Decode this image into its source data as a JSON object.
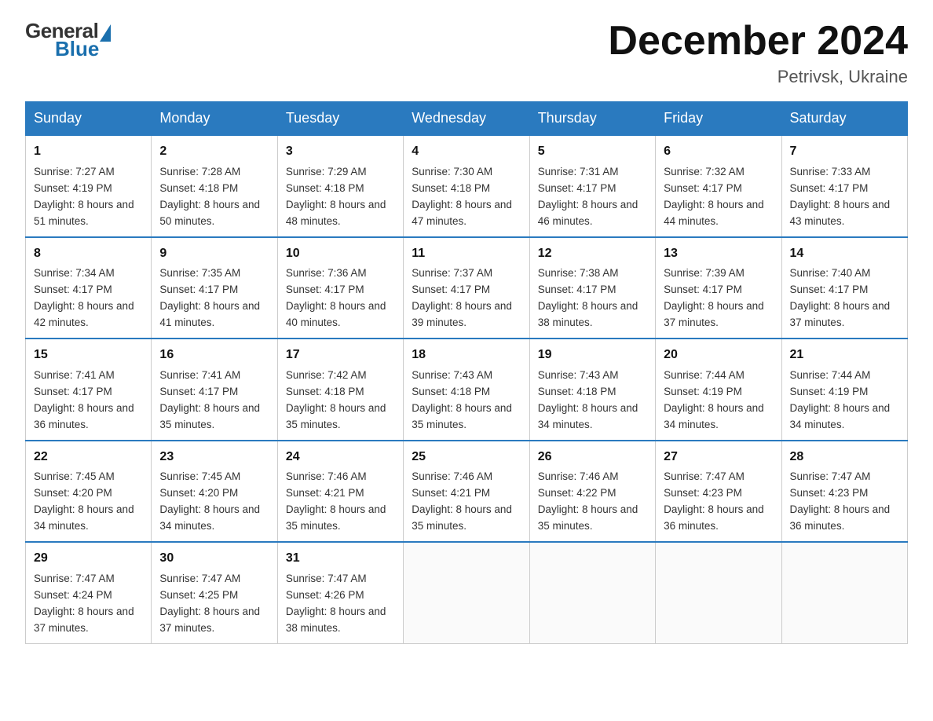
{
  "header": {
    "logo_general": "General",
    "logo_blue": "Blue",
    "month_title": "December 2024",
    "location": "Petrivsk, Ukraine"
  },
  "calendar": {
    "days_of_week": [
      "Sunday",
      "Monday",
      "Tuesday",
      "Wednesday",
      "Thursday",
      "Friday",
      "Saturday"
    ],
    "weeks": [
      [
        {
          "day": "1",
          "sunrise": "Sunrise: 7:27 AM",
          "sunset": "Sunset: 4:19 PM",
          "daylight": "Daylight: 8 hours and 51 minutes."
        },
        {
          "day": "2",
          "sunrise": "Sunrise: 7:28 AM",
          "sunset": "Sunset: 4:18 PM",
          "daylight": "Daylight: 8 hours and 50 minutes."
        },
        {
          "day": "3",
          "sunrise": "Sunrise: 7:29 AM",
          "sunset": "Sunset: 4:18 PM",
          "daylight": "Daylight: 8 hours and 48 minutes."
        },
        {
          "day": "4",
          "sunrise": "Sunrise: 7:30 AM",
          "sunset": "Sunset: 4:18 PM",
          "daylight": "Daylight: 8 hours and 47 minutes."
        },
        {
          "day": "5",
          "sunrise": "Sunrise: 7:31 AM",
          "sunset": "Sunset: 4:17 PM",
          "daylight": "Daylight: 8 hours and 46 minutes."
        },
        {
          "day": "6",
          "sunrise": "Sunrise: 7:32 AM",
          "sunset": "Sunset: 4:17 PM",
          "daylight": "Daylight: 8 hours and 44 minutes."
        },
        {
          "day": "7",
          "sunrise": "Sunrise: 7:33 AM",
          "sunset": "Sunset: 4:17 PM",
          "daylight": "Daylight: 8 hours and 43 minutes."
        }
      ],
      [
        {
          "day": "8",
          "sunrise": "Sunrise: 7:34 AM",
          "sunset": "Sunset: 4:17 PM",
          "daylight": "Daylight: 8 hours and 42 minutes."
        },
        {
          "day": "9",
          "sunrise": "Sunrise: 7:35 AM",
          "sunset": "Sunset: 4:17 PM",
          "daylight": "Daylight: 8 hours and 41 minutes."
        },
        {
          "day": "10",
          "sunrise": "Sunrise: 7:36 AM",
          "sunset": "Sunset: 4:17 PM",
          "daylight": "Daylight: 8 hours and 40 minutes."
        },
        {
          "day": "11",
          "sunrise": "Sunrise: 7:37 AM",
          "sunset": "Sunset: 4:17 PM",
          "daylight": "Daylight: 8 hours and 39 minutes."
        },
        {
          "day": "12",
          "sunrise": "Sunrise: 7:38 AM",
          "sunset": "Sunset: 4:17 PM",
          "daylight": "Daylight: 8 hours and 38 minutes."
        },
        {
          "day": "13",
          "sunrise": "Sunrise: 7:39 AM",
          "sunset": "Sunset: 4:17 PM",
          "daylight": "Daylight: 8 hours and 37 minutes."
        },
        {
          "day": "14",
          "sunrise": "Sunrise: 7:40 AM",
          "sunset": "Sunset: 4:17 PM",
          "daylight": "Daylight: 8 hours and 37 minutes."
        }
      ],
      [
        {
          "day": "15",
          "sunrise": "Sunrise: 7:41 AM",
          "sunset": "Sunset: 4:17 PM",
          "daylight": "Daylight: 8 hours and 36 minutes."
        },
        {
          "day": "16",
          "sunrise": "Sunrise: 7:41 AM",
          "sunset": "Sunset: 4:17 PM",
          "daylight": "Daylight: 8 hours and 35 minutes."
        },
        {
          "day": "17",
          "sunrise": "Sunrise: 7:42 AM",
          "sunset": "Sunset: 4:18 PM",
          "daylight": "Daylight: 8 hours and 35 minutes."
        },
        {
          "day": "18",
          "sunrise": "Sunrise: 7:43 AM",
          "sunset": "Sunset: 4:18 PM",
          "daylight": "Daylight: 8 hours and 35 minutes."
        },
        {
          "day": "19",
          "sunrise": "Sunrise: 7:43 AM",
          "sunset": "Sunset: 4:18 PM",
          "daylight": "Daylight: 8 hours and 34 minutes."
        },
        {
          "day": "20",
          "sunrise": "Sunrise: 7:44 AM",
          "sunset": "Sunset: 4:19 PM",
          "daylight": "Daylight: 8 hours and 34 minutes."
        },
        {
          "day": "21",
          "sunrise": "Sunrise: 7:44 AM",
          "sunset": "Sunset: 4:19 PM",
          "daylight": "Daylight: 8 hours and 34 minutes."
        }
      ],
      [
        {
          "day": "22",
          "sunrise": "Sunrise: 7:45 AM",
          "sunset": "Sunset: 4:20 PM",
          "daylight": "Daylight: 8 hours and 34 minutes."
        },
        {
          "day": "23",
          "sunrise": "Sunrise: 7:45 AM",
          "sunset": "Sunset: 4:20 PM",
          "daylight": "Daylight: 8 hours and 34 minutes."
        },
        {
          "day": "24",
          "sunrise": "Sunrise: 7:46 AM",
          "sunset": "Sunset: 4:21 PM",
          "daylight": "Daylight: 8 hours and 35 minutes."
        },
        {
          "day": "25",
          "sunrise": "Sunrise: 7:46 AM",
          "sunset": "Sunset: 4:21 PM",
          "daylight": "Daylight: 8 hours and 35 minutes."
        },
        {
          "day": "26",
          "sunrise": "Sunrise: 7:46 AM",
          "sunset": "Sunset: 4:22 PM",
          "daylight": "Daylight: 8 hours and 35 minutes."
        },
        {
          "day": "27",
          "sunrise": "Sunrise: 7:47 AM",
          "sunset": "Sunset: 4:23 PM",
          "daylight": "Daylight: 8 hours and 36 minutes."
        },
        {
          "day": "28",
          "sunrise": "Sunrise: 7:47 AM",
          "sunset": "Sunset: 4:23 PM",
          "daylight": "Daylight: 8 hours and 36 minutes."
        }
      ],
      [
        {
          "day": "29",
          "sunrise": "Sunrise: 7:47 AM",
          "sunset": "Sunset: 4:24 PM",
          "daylight": "Daylight: 8 hours and 37 minutes."
        },
        {
          "day": "30",
          "sunrise": "Sunrise: 7:47 AM",
          "sunset": "Sunset: 4:25 PM",
          "daylight": "Daylight: 8 hours and 37 minutes."
        },
        {
          "day": "31",
          "sunrise": "Sunrise: 7:47 AM",
          "sunset": "Sunset: 4:26 PM",
          "daylight": "Daylight: 8 hours and 38 minutes."
        },
        null,
        null,
        null,
        null
      ]
    ]
  }
}
